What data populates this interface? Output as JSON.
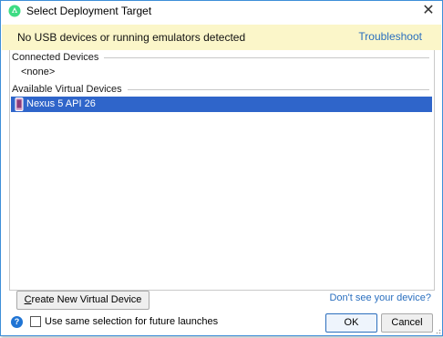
{
  "window": {
    "title": "Select Deployment Target",
    "app_icon": "android-studio-icon",
    "close_icon": "close-icon"
  },
  "banner": {
    "message": "No USB devices or running emulators detected",
    "link": "Troubleshoot"
  },
  "devices": {
    "connected_header": "Connected Devices",
    "connected_empty": "<none>",
    "available_header": "Available Virtual Devices",
    "available": [
      {
        "label": "Nexus 5 API 26",
        "icon": "phone-icon",
        "selected": true
      }
    ]
  },
  "footer": {
    "create_button_mnemonic": "C",
    "create_button_rest": "reate New Virtual Device",
    "dont_see_link": "Don't see your device?",
    "help_icon": "help-icon",
    "checkbox_label": "Use same selection for future launches",
    "checkbox_checked": false,
    "ok_label": "OK",
    "cancel_label": "Cancel"
  },
  "colors": {
    "selection": "#2f65ca",
    "banner_bg": "#fbf6c9",
    "link": "#2a6fbf",
    "window_border": "#3e8fd8"
  }
}
